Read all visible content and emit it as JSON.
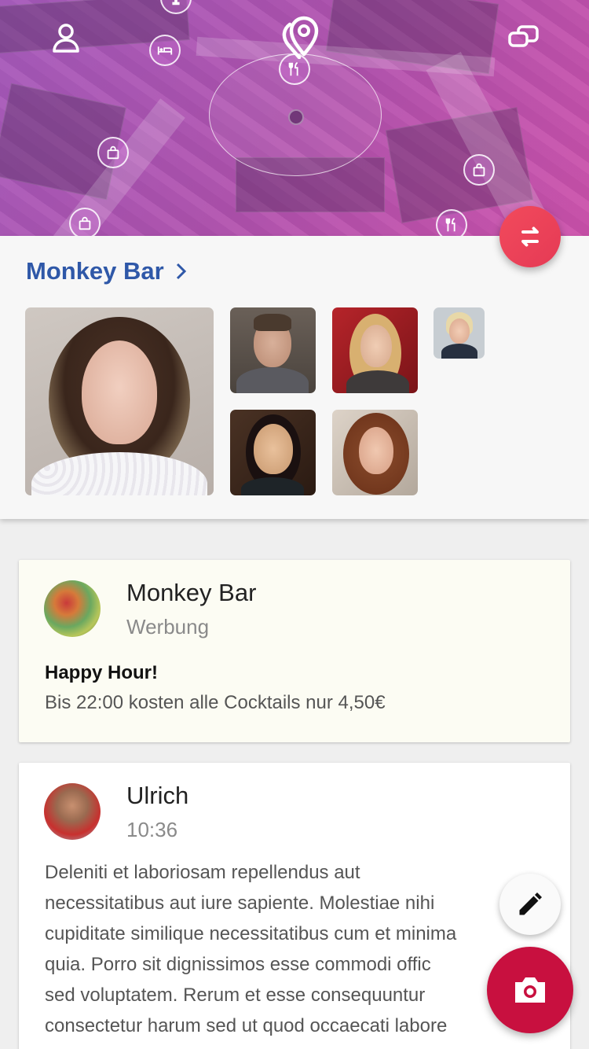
{
  "header": {
    "profile_icon": "person-outline-icon",
    "location_icon": "location-pin-icon",
    "chat_icon": "chat-bubbles-icon",
    "map_pois": [
      "cocktail-icon",
      "hotel-icon",
      "restaurant-icon",
      "shopping-bag-icon",
      "shopping-bag-icon",
      "shopping-bag-icon",
      "restaurant-icon"
    ],
    "switch_icon": "swap-icon"
  },
  "venue": {
    "name": "Monkey Bar",
    "chevron_icon": "chevron-right-icon"
  },
  "feed": {
    "ad": {
      "author": "Monkey Bar",
      "label": "Werbung",
      "headline": "Happy Hour!",
      "text": "Bis 22:00 kosten alle Cocktails nur 4,50€"
    },
    "post": {
      "author": "Ulrich",
      "time": "10:36",
      "lines": [
        "Deleniti et laboriosam repellendus aut",
        "necessitatibus aut iure sapiente. Molestiae nihi",
        "cupiditate similique necessitatibus cum et minima",
        "quia. Porro sit dignissimos esse commodi offic",
        "sed voluptatem. Rerum et esse consequuntur",
        "consectetur harum sed ut quod occaecati labore"
      ]
    }
  },
  "actions": {
    "edit_icon": "pencil-icon",
    "camera_icon": "camera-icon"
  },
  "colors": {
    "accent": "#2f58a8",
    "switch_fab": "#ef4459",
    "camera_fab": "#c8103f",
    "ad_background": "#fcfcf3"
  }
}
